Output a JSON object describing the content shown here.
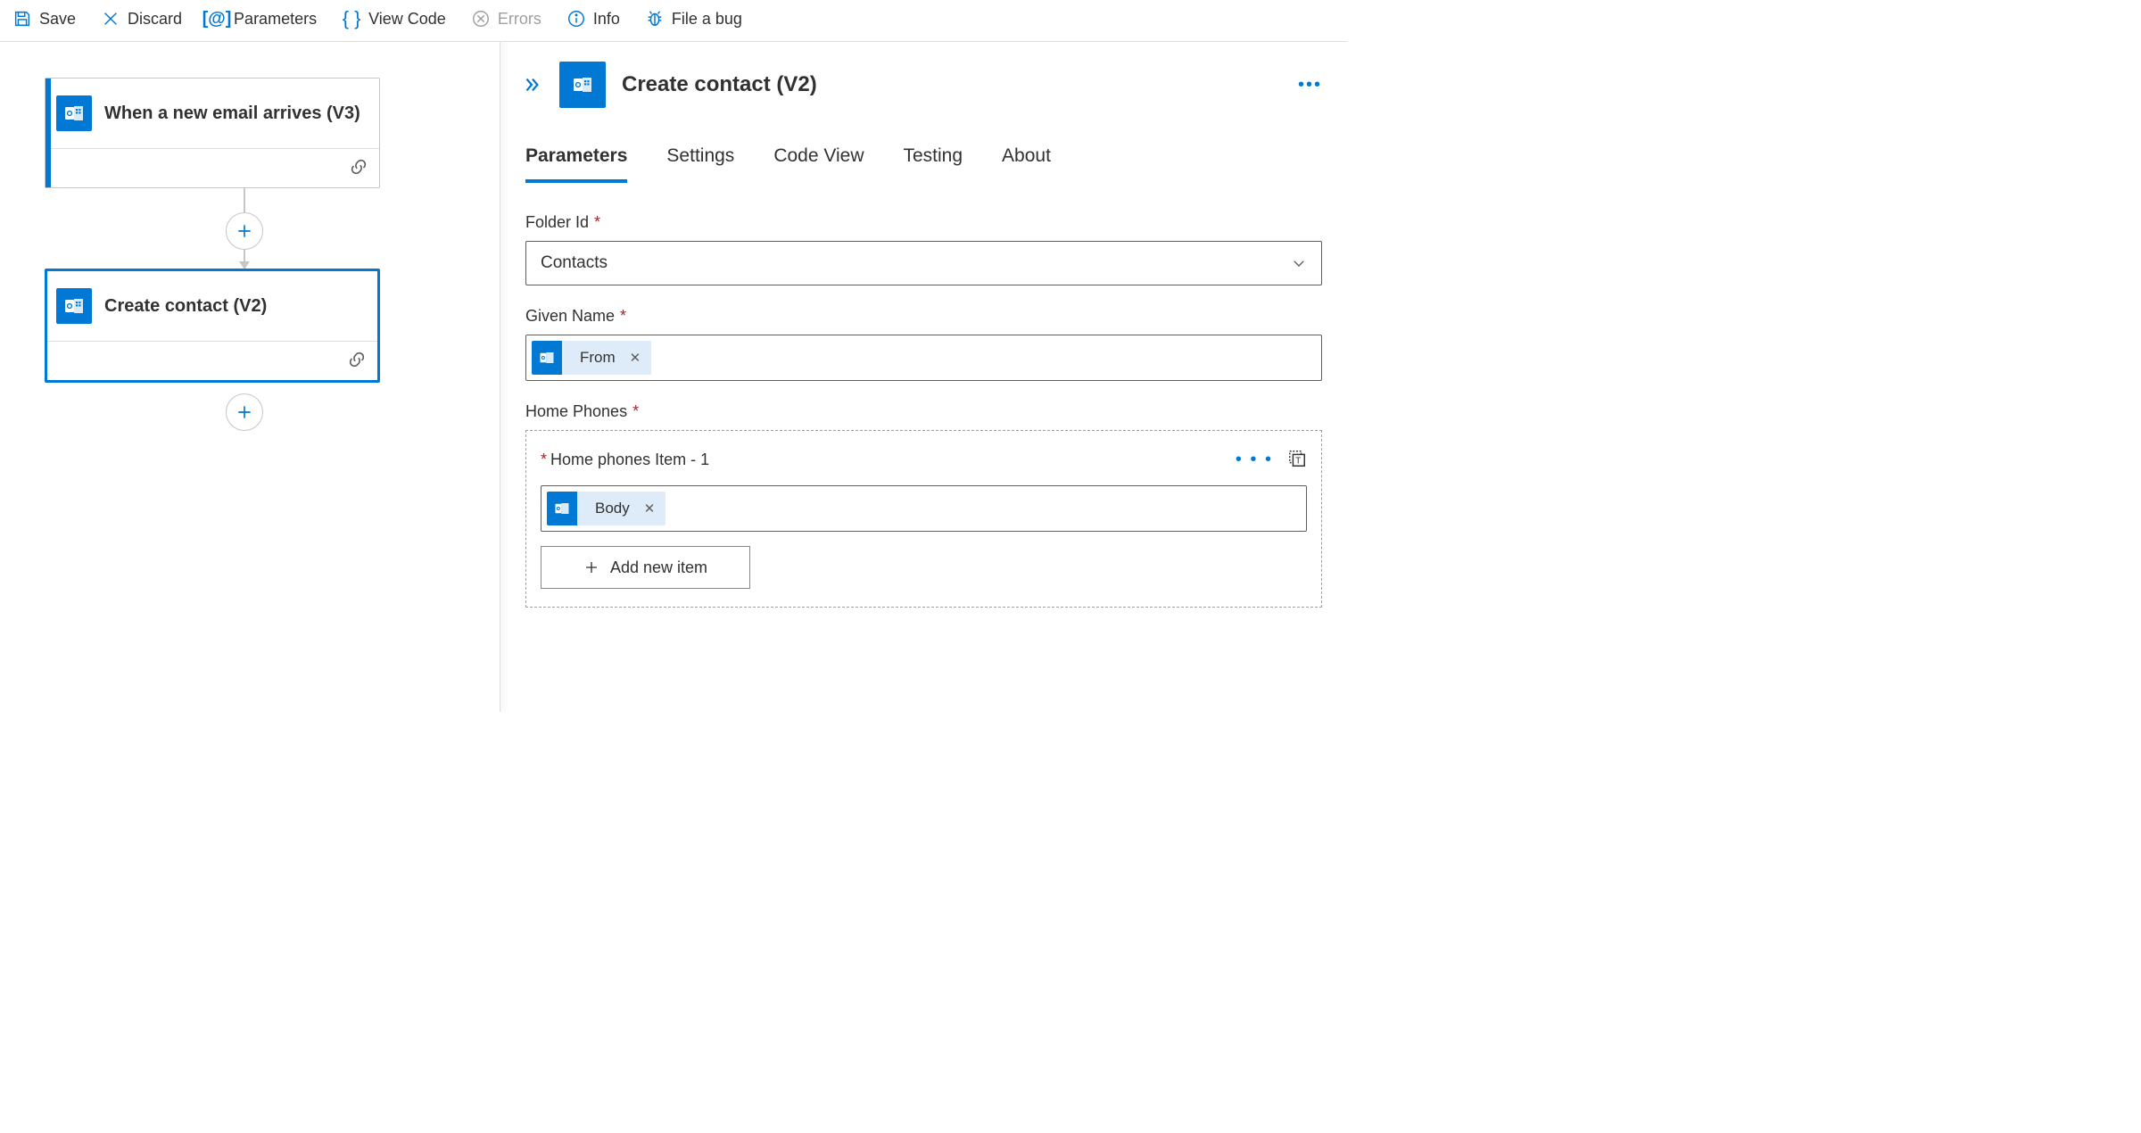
{
  "toolbar": {
    "save": "Save",
    "discard": "Discard",
    "parameters": "Parameters",
    "viewcode": "View Code",
    "errors": "Errors",
    "info": "Info",
    "filebug": "File a bug"
  },
  "canvas": {
    "card1_title": "When a new email arrives (V3)",
    "card2_title": "Create contact (V2)"
  },
  "panel": {
    "title": "Create contact (V2)",
    "tabs": [
      "Parameters",
      "Settings",
      "Code View",
      "Testing",
      "About"
    ],
    "folder_label": "Folder Id",
    "folder_value": "Contacts",
    "given_label": "Given Name",
    "given_token": "From",
    "home_label": "Home Phones",
    "item_label": "Home phones Item - 1",
    "item_token": "Body",
    "add_item": "Add new item"
  }
}
